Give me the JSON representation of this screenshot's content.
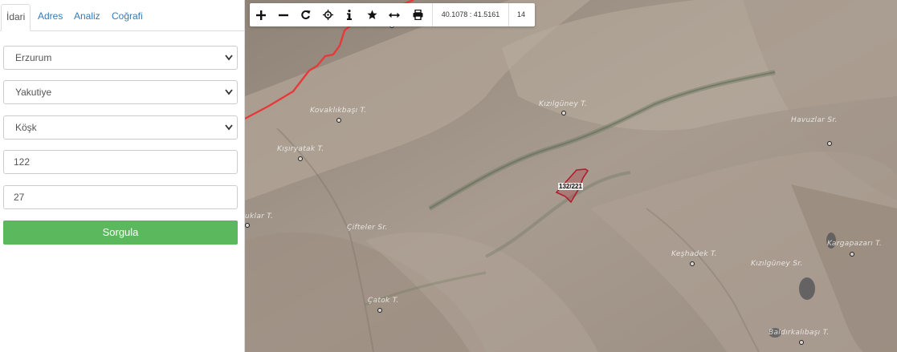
{
  "sidebar": {
    "tabs": [
      {
        "label": "İdari",
        "active": true
      },
      {
        "label": "Adres",
        "active": false
      },
      {
        "label": "Analiz",
        "active": false
      },
      {
        "label": "Coğrafi",
        "active": false
      }
    ],
    "province": "Erzurum",
    "district": "Yakutiye",
    "neighborhood": "Köşk",
    "block": "122",
    "parcel": "27",
    "query_button": "Sorgula"
  },
  "toolbar": {
    "coordinates": "40.1078 : 41.5161",
    "zoom_level": "14",
    "icons": [
      "zoom-in-icon",
      "zoom-out-icon",
      "refresh-icon",
      "locate-icon",
      "info-icon",
      "star-icon",
      "measure-icon",
      "print-icon"
    ]
  },
  "map": {
    "parcel_label": "132/221",
    "places": [
      {
        "name": "Kovaklıkbaşı T.",
        "id": "kovaklikbasi"
      },
      {
        "name": "Kızılgüney T.",
        "id": "kizilguney-t"
      },
      {
        "name": "Havuzlar Sr.",
        "id": "havuzlar"
      },
      {
        "name": "Kışıryatak T.",
        "id": "kisiryatak"
      },
      {
        "name": "uklar T.",
        "id": "uklar"
      },
      {
        "name": "Çifteler Sr.",
        "id": "cifteler"
      },
      {
        "name": "Keşhadek T.",
        "id": "keshadek"
      },
      {
        "name": "Kızılgüney Sr.",
        "id": "kizilguney-sr"
      },
      {
        "name": "Kargapazarı T.",
        "id": "kargapazari"
      },
      {
        "name": "Çatok T.",
        "id": "catok"
      },
      {
        "name": "Baldırkalıbaşı T.",
        "id": "baldirkalibasi"
      }
    ]
  },
  "colors": {
    "accent": "#337ab7",
    "button": "#5cb85c",
    "boundary": "#e8393a",
    "parcel": "#b01e2e"
  }
}
